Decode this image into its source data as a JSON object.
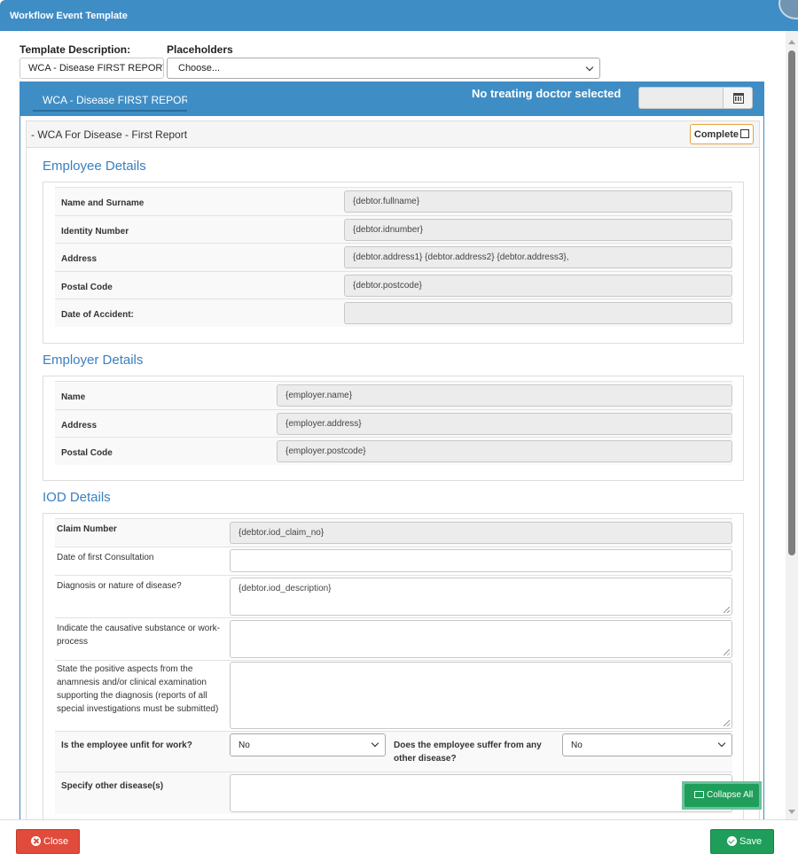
{
  "window": {
    "title": "Workflow Event Template"
  },
  "top": {
    "template_description_label": "Template Description:",
    "template_description_value": "WCA - Disease FIRST REPORT",
    "placeholders_label": "Placeholders",
    "placeholders_value": "Choose..."
  },
  "panel": {
    "tab_label": "WCA - Disease FIRST REPORT",
    "doctor_status": "No treating doctor selected",
    "date_value": ""
  },
  "form": {
    "title": "WCA For Disease - First Report",
    "collapse_marker": "-",
    "complete_label": "Complete"
  },
  "employee": {
    "title": "Employee Details",
    "rows": [
      {
        "label": "Name and Surname",
        "value": "{debtor.fullname}"
      },
      {
        "label": "Identity Number",
        "value": "{debtor.idnumber}"
      },
      {
        "label": "Address",
        "value": "{debtor.address1} {debtor.address2} {debtor.address3},"
      },
      {
        "label": "Postal Code",
        "value": "{debtor.postcode}"
      },
      {
        "label": "Date of Accident:",
        "value": ""
      }
    ]
  },
  "employer": {
    "title": "Employer Details",
    "rows": [
      {
        "label": "Name",
        "value": "{employer.name}"
      },
      {
        "label": "Address",
        "value": "{employer.address}"
      },
      {
        "label": "Postal Code",
        "value": "{employer.postcode}"
      }
    ]
  },
  "iod": {
    "title": "IOD Details",
    "claim_number_label": "Claim Number",
    "claim_number_value": "{debtor.iod_claim_no}",
    "first_consult_label": "Date of first Consultation",
    "first_consult_value": "",
    "diagnosis_label": "Diagnosis or nature of disease?",
    "diagnosis_value": "{debtor.iod_description}",
    "causative_label": "Indicate the causative substance or work-process",
    "causative_value": "",
    "positive_aspects_label": "State the positive aspects from the anamnesis and/or clinical examination supporting the diagnosis (reports of all special investigations must be submitted)",
    "positive_aspects_value": "",
    "unfit_label": "Is the employee unfit for work?",
    "unfit_value": "No",
    "other_disease_label": "Does the employee suffer from any other disease?",
    "other_disease_value": "No",
    "specify_label": "Specify other disease(s)",
    "specify_value": ""
  },
  "buttons": {
    "collapse_all": "Collapse All",
    "close": "Close",
    "save": "Save"
  }
}
